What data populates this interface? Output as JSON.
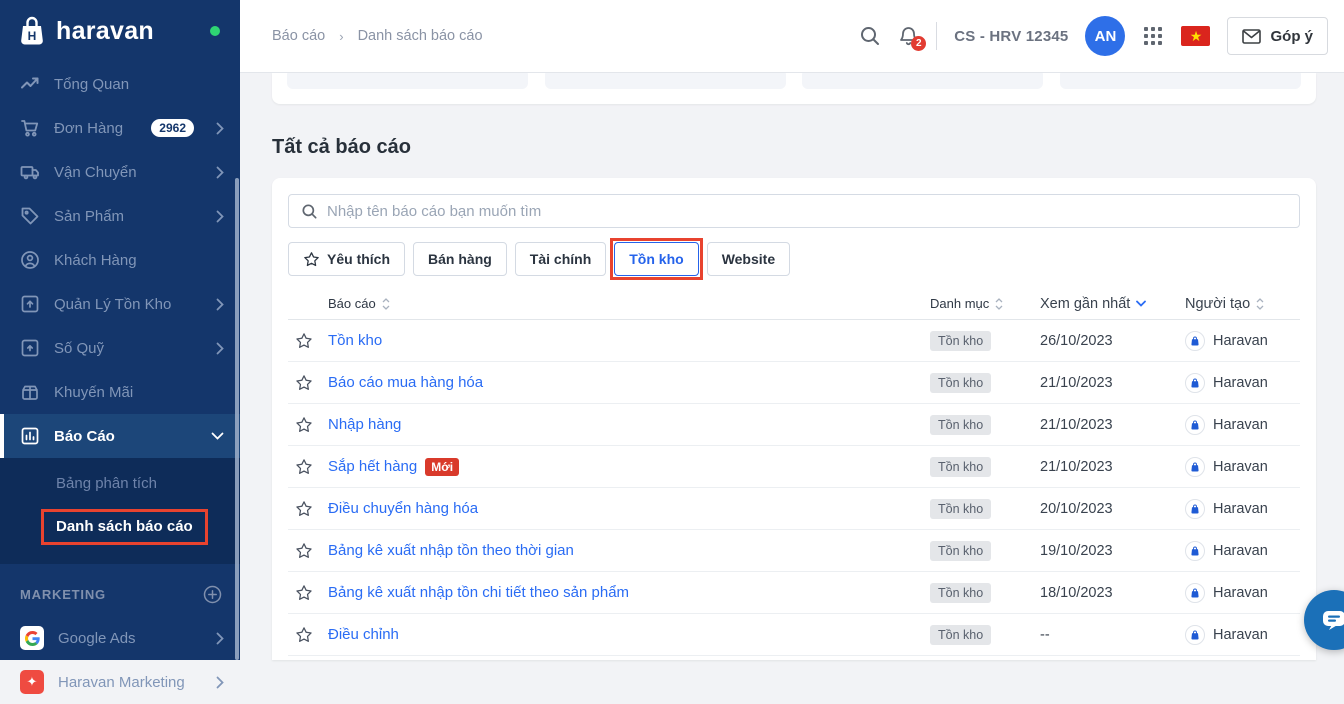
{
  "colors": {
    "sidebar_bg": "#14366b",
    "sidebar_active_bg": "#1c4679",
    "submenu_bg": "#0e2c59",
    "annotation_red": "#e8432f",
    "link_blue": "#2a6cf4",
    "selected_filter_blue": "#2563eb",
    "new_badge_red": "#d93a2b",
    "avatar_blue": "#2e6fe8",
    "online_dot_green": "#2fd573",
    "flag_red": "#da251d",
    "flag_star_yellow": "#ffdd00",
    "chat_fab_blue": "#1b70b8"
  },
  "sidebar": {
    "logo_text": "haravan",
    "items": [
      {
        "label": "Tổng Quan"
      },
      {
        "label": "Đơn Hàng",
        "badge": "2962"
      },
      {
        "label": "Vận Chuyển"
      },
      {
        "label": "Sản Phẩm"
      },
      {
        "label": "Khách Hàng"
      },
      {
        "label": "Quản Lý Tồn Kho"
      },
      {
        "label": "Số Quỹ"
      },
      {
        "label": "Khuyến Mãi"
      },
      {
        "label": "Báo Cáo"
      }
    ],
    "submenu": [
      "Bảng phân tích",
      "Danh sách báo cáo"
    ],
    "marketing_section": "MARKETING",
    "marketing_items": [
      {
        "label": "Google Ads"
      },
      {
        "label": "Haravan Marketing"
      }
    ]
  },
  "header": {
    "breadcrumb": [
      "Báo cáo",
      "Danh sách báo cáo"
    ],
    "notification_count": "2",
    "account_label": "CS - HRV 12345",
    "avatar_initials": "AN",
    "feedback_label": "Góp ý"
  },
  "main": {
    "title": "Tất cả báo cáo",
    "search_placeholder": "Nhập tên báo cáo bạn muốn tìm",
    "filters": [
      {
        "label": "Yêu thích"
      },
      {
        "label": "Bán hàng"
      },
      {
        "label": "Tài chính"
      },
      {
        "label": "Tồn kho",
        "selected": true
      },
      {
        "label": "Website"
      }
    ],
    "table": {
      "columns": [
        "Báo cáo",
        "Danh mục",
        "Xem gần nhất",
        "Người tạo"
      ],
      "rows": [
        {
          "name": "Tồn kho",
          "category": "Tồn kho",
          "last_viewed": "26/10/2023",
          "creator": "Haravan"
        },
        {
          "name": "Báo cáo mua hàng hóa",
          "category": "Tồn kho",
          "last_viewed": "21/10/2023",
          "creator": "Haravan"
        },
        {
          "name": "Nhập hàng",
          "category": "Tồn kho",
          "last_viewed": "21/10/2023",
          "creator": "Haravan"
        },
        {
          "name": "Sắp hết hàng",
          "new_badge": "Mới",
          "category": "Tồn kho",
          "last_viewed": "21/10/2023",
          "creator": "Haravan"
        },
        {
          "name": "Điều chuyển hàng hóa",
          "category": "Tồn kho",
          "last_viewed": "20/10/2023",
          "creator": "Haravan"
        },
        {
          "name": "Bảng kê xuất nhập tồn theo thời gian",
          "category": "Tồn kho",
          "last_viewed": "19/10/2023",
          "creator": "Haravan"
        },
        {
          "name": "Bảng kê xuất nhập tồn chi tiết theo sản phẩm",
          "category": "Tồn kho",
          "last_viewed": "18/10/2023",
          "creator": "Haravan"
        },
        {
          "name": "Điều chỉnh",
          "category": "Tồn kho",
          "last_viewed": "--",
          "creator": "Haravan"
        }
      ]
    }
  }
}
